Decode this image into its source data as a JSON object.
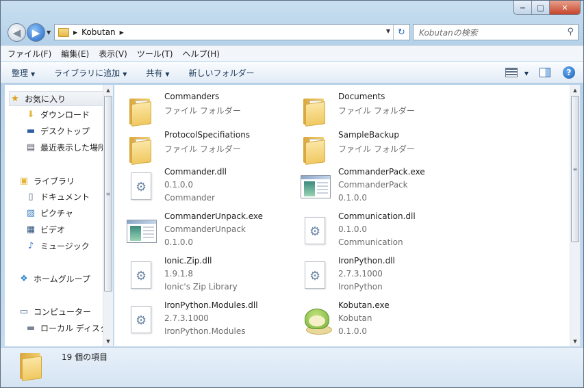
{
  "window": {
    "caption_buttons": [
      "−",
      "□",
      "✕"
    ]
  },
  "nav": {
    "breadcrumb": "Kobutan",
    "search_placeholder": "Kobutanの検索"
  },
  "menu": [
    "ファイル(F)",
    "編集(E)",
    "表示(V)",
    "ツール(T)",
    "ヘルプ(H)"
  ],
  "commands": [
    "整理",
    "ライブラリに追加",
    "共有",
    "新しいフォルダー"
  ],
  "sidebar": {
    "items": [
      {
        "label": "お気に入り",
        "icon": "star-icon",
        "selected": true
      },
      {
        "label": "ダウンロード",
        "icon": "downloads-icon"
      },
      {
        "label": "デスクトップ",
        "icon": "desktop-icon"
      },
      {
        "label": "最近表示した場所",
        "icon": "recent-places-icon"
      },
      {
        "label": "ライブラリ",
        "icon": "library-icon"
      },
      {
        "label": "ドキュメント",
        "icon": "documents-icon"
      },
      {
        "label": "ピクチャ",
        "icon": "pictures-icon"
      },
      {
        "label": "ビデオ",
        "icon": "videos-icon"
      },
      {
        "label": "ミュージック",
        "icon": "music-icon"
      },
      {
        "label": "ホームグループ",
        "icon": "homegroup-icon"
      },
      {
        "label": "コンピューター",
        "icon": "computer-icon"
      },
      {
        "label": "ローカル ディスク",
        "icon": "local-disk-icon"
      }
    ]
  },
  "files": [
    {
      "name": "Commanders",
      "line2": "ファイル フォルダー",
      "line3": "",
      "type": "folder"
    },
    {
      "name": "Documents",
      "line2": "ファイル フォルダー",
      "line3": "",
      "type": "folder"
    },
    {
      "name": "ProtocolSpecifiations",
      "line2": "ファイル フォルダー",
      "line3": "",
      "type": "folder"
    },
    {
      "name": "SampleBackup",
      "line2": "ファイル フォルダー",
      "line3": "",
      "type": "folder"
    },
    {
      "name": "Commander.dll",
      "line2": "0.1.0.0",
      "line3": "Commander",
      "type": "dll"
    },
    {
      "name": "CommanderPack.exe",
      "line2": "CommanderPack",
      "line3": "0.1.0.0",
      "type": "exe"
    },
    {
      "name": "CommanderUnpack.exe",
      "line2": "CommanderUnpack",
      "line3": "0.1.0.0",
      "type": "exe"
    },
    {
      "name": "Communication.dll",
      "line2": "0.1.0.0",
      "line3": "Communication",
      "type": "dll"
    },
    {
      "name": "Ionic.Zip.dll",
      "line2": "1.9.1.8",
      "line3": "Ionic's Zip Library",
      "type": "dll"
    },
    {
      "name": "IronPython.dll",
      "line2": "2.7.3.1000",
      "line3": "IronPython",
      "type": "dll"
    },
    {
      "name": "IronPython.Modules.dll",
      "line2": "2.7.3.1000",
      "line3": "IronPython.Modules",
      "type": "dll"
    },
    {
      "name": "Kobutan.exe",
      "line2": "Kobutan",
      "line3": "0.1.0.0",
      "type": "kobutan"
    }
  ],
  "status": {
    "item_count": "19 個の項目"
  }
}
